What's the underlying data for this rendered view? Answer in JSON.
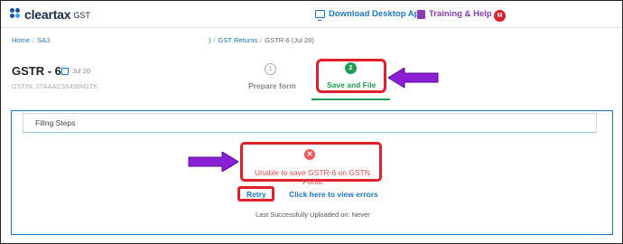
{
  "header": {
    "logo_text": "cleartax",
    "logo_suffix": "GST",
    "download_label": "Download Desktop App",
    "training_label": "Training & Help",
    "avatar_initial": "M"
  },
  "breadcrumb": {
    "home": "Home",
    "company": "SAJ.",
    "company_suffix": ")",
    "returns": "GST Returns",
    "current": "GSTR-6 (Jul 20)"
  },
  "page": {
    "title": "GSTR - 6",
    "period": "Jul 20",
    "gstin": "GSTIN: 27AAACS6498M2ZK"
  },
  "stepper": {
    "steps": [
      {
        "number": "1",
        "label": "Prepare form"
      },
      {
        "number": "2",
        "label": "Save and File"
      }
    ]
  },
  "panel": {
    "card_title": "Filing Steps",
    "error_icon": "close-icon",
    "error_message": "Unable to save GSTR-6 on GSTN Portal",
    "retry_label": "Retry",
    "view_errors_label": "Click here to view errors",
    "last_uploaded": "Last Successfully Uploaded on: Never"
  },
  "colors": {
    "brand_blue": "#1a78c8",
    "success_green": "#1f9e55",
    "error_red": "#e84a4a",
    "highlight_red": "#e0202a",
    "arrow_purple": "#8b1fd6"
  }
}
